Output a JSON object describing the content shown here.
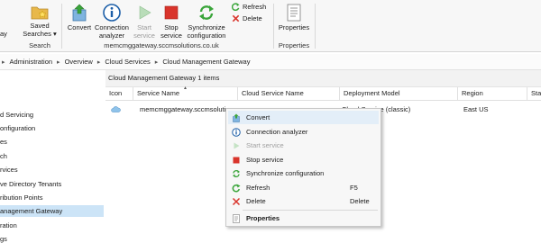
{
  "ribbon": {
    "partial_left": "ay",
    "saved_searches_label": "Saved Searches ▾",
    "search_group": "Search",
    "convert": "Convert",
    "connection_analyzer": "Connection analyzer",
    "start_service": "Start service",
    "stop_service": "Stop service",
    "sync_config": "Synchronize configuration",
    "gateway_group": "memcmggateway.sccmsolutions.co.uk",
    "refresh": "Refresh",
    "delete": "Delete",
    "properties": "Properties",
    "properties_group": "Properties"
  },
  "breadcrumb": [
    "Administration",
    "Overview",
    "Cloud Services",
    "Cloud Management Gateway"
  ],
  "nav": {
    "items": [
      "d Servicing",
      "onfiguration",
      "es",
      "ch",
      "rvices",
      "ve Directory Tenants",
      "ribution Points",
      "anagement Gateway",
      "ration",
      "gs"
    ],
    "selected_index": 7
  },
  "list": {
    "title": "Cloud Management Gateway 1 items",
    "columns": [
      "Icon",
      "Service Name",
      "Cloud Service Name",
      "Deployment Model",
      "Region",
      "Sta"
    ],
    "row": {
      "service_name": "memcmggateway.sccmsoluti",
      "deployment_model": "Cloud Service (classic)",
      "region": "East US"
    }
  },
  "context_menu": {
    "items": [
      {
        "label": "Convert",
        "icon": "convert-icon",
        "enabled": true
      },
      {
        "label": "Connection analyzer",
        "icon": "info-icon",
        "enabled": true
      },
      {
        "label": "Start service",
        "icon": "play-icon",
        "enabled": false
      },
      {
        "label": "Stop service",
        "icon": "stop-icon",
        "enabled": true
      },
      {
        "label": "Synchronize configuration",
        "icon": "sync-icon",
        "enabled": true
      },
      {
        "label": "Refresh",
        "icon": "refresh-icon",
        "enabled": true,
        "shortcut": "F5"
      },
      {
        "label": "Delete",
        "icon": "delete-icon",
        "enabled": true,
        "shortcut": "Delete"
      },
      {
        "label": "Properties",
        "icon": "properties-icon",
        "enabled": true,
        "bold": true
      }
    ]
  },
  "colors": {
    "selection": "#cce4f7",
    "green": "#3aa53a",
    "red": "#d9342b",
    "blue_info": "#1d5fa8"
  }
}
